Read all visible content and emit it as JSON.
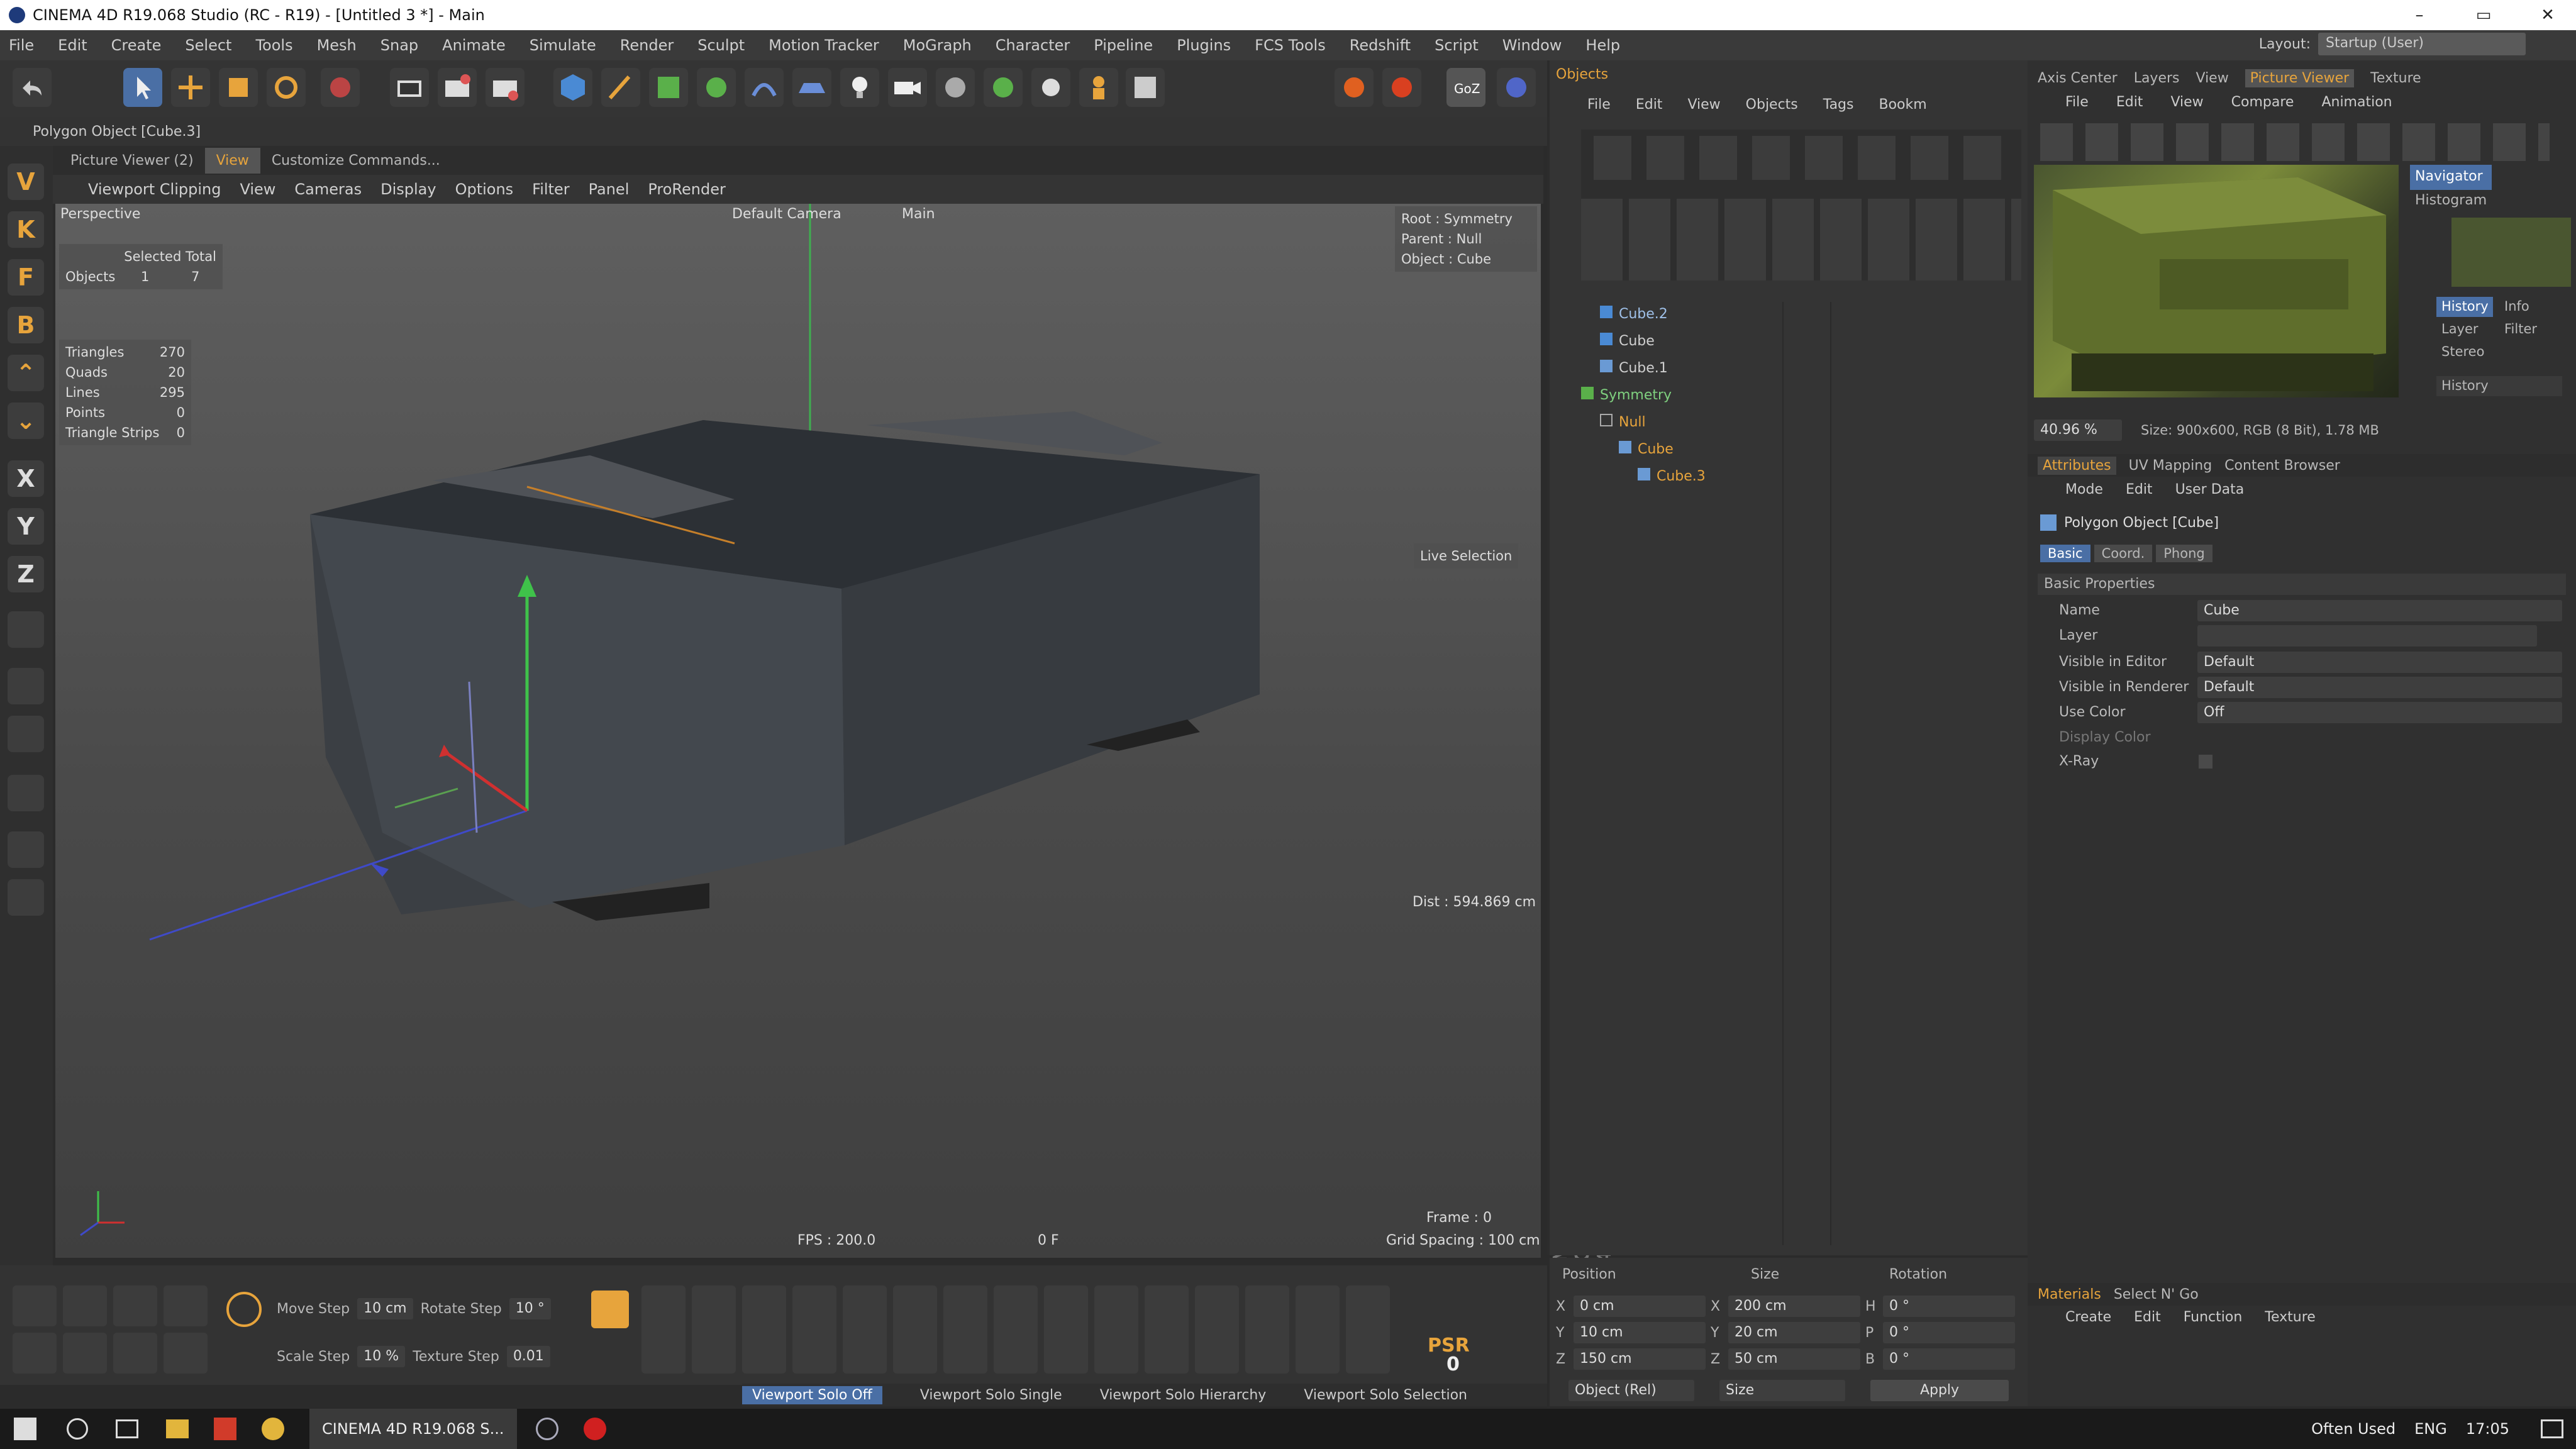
{
  "window": {
    "title": "CINEMA 4D R19.068 Studio (RC - R19) - [Untitled 3 *] - Main",
    "min": "–",
    "max": "▭",
    "close": "✕"
  },
  "menu": [
    "File",
    "Edit",
    "Create",
    "Select",
    "Tools",
    "Mesh",
    "Snap",
    "Animate",
    "Simulate",
    "Render",
    "Sculpt",
    "Motion Tracker",
    "MoGraph",
    "Character",
    "Pipeline",
    "Plugins",
    "FCS Tools",
    "Redshift",
    "Script",
    "Window",
    "Help"
  ],
  "layout": {
    "label": "Layout:",
    "value": "Startup (User)"
  },
  "subbar": {
    "object_label": "Polygon Object [Cube.3]"
  },
  "viewport_tabs": [
    "Picture Viewer (2)",
    "View",
    "Customize Commands..."
  ],
  "viewport_menu": [
    "Viewport Clipping",
    "View",
    "Cameras",
    "Display",
    "Options",
    "Filter",
    "Panel",
    "ProRender"
  ],
  "viewport": {
    "perspective": "Perspective",
    "camera": "Default Camera",
    "main": "Main",
    "selected_hdr": "Selected Total",
    "objects_label": "Objects",
    "objects_sel": "1",
    "objects_total": "7",
    "triangles": "Triangles",
    "triangles_v": "270",
    "quads": "Quads",
    "quads_v": "20",
    "lines": "Lines",
    "lines_v": "295",
    "points": "Points",
    "points_v": "0",
    "strips": "Triangle Strips",
    "strips_v": "0",
    "root": "Root : Symmetry",
    "parent": "Parent : Null",
    "object": "Object : Cube",
    "live": "Live Selection",
    "dist": "Dist : 594.869 cm",
    "fps": "FPS : 200.0",
    "frame0": "0 F",
    "frame": "Frame : 0",
    "grid": "Grid Spacing : 100 cm"
  },
  "left_tools": [
    "V",
    "K",
    "F",
    "B",
    "⌃",
    "⌄",
    "X",
    "Y",
    "Z"
  ],
  "bottom": {
    "move_step": "Move Step",
    "move_val": "10 cm",
    "rotate_step": "Rotate Step",
    "rotate_val": "10 °",
    "scale_step": "Scale Step",
    "scale_val": "10 %",
    "texture_step": "Texture Step",
    "texture_val": "0.01",
    "psr": "PSR",
    "psr_val": "0"
  },
  "solo": [
    "Viewport Solo Off",
    "Viewport Solo Single",
    "Viewport Solo Hierarchy",
    "Viewport Solo Selection"
  ],
  "objects_panel": {
    "title": "Objects",
    "menu": [
      "File",
      "Edit",
      "View",
      "Objects",
      "Tags",
      "Bookm"
    ],
    "items": [
      {
        "name": "Cube.2",
        "color": "#9fc0e8"
      },
      {
        "name": "Cube",
        "color": "#cfcfcf"
      },
      {
        "name": "Cube.1",
        "color": "#cfcfcf"
      },
      {
        "name": "Symmetry",
        "color": "#7fd07f"
      },
      {
        "name": "Null",
        "color": "#e7a43c"
      },
      {
        "name": "Cube",
        "color": "#e7a43c"
      },
      {
        "name": "Cube.3",
        "color": "#e7a43c"
      }
    ]
  },
  "right_tabs": [
    "Axis Center",
    "Layers",
    "View",
    "Picture Viewer",
    "Texture"
  ],
  "pv_menu": [
    "File",
    "Edit",
    "View",
    "Compare",
    "Animation"
  ],
  "pv": {
    "navigator": "Navigator",
    "histogram": "Histogram",
    "history": "History",
    "info": "Info",
    "layer": "Layer",
    "filter": "Filter",
    "stereo": "Stereo",
    "history2": "History",
    "zoom": "40.96 %",
    "size": "Size: 900x600, RGB (8 Bit), 1.78 MB"
  },
  "attr_tabs": [
    "Attributes",
    "UV Mapping",
    "Content Browser"
  ],
  "attr_menu": [
    "Mode",
    "Edit",
    "User Data"
  ],
  "attr": {
    "title": "Polygon Object [Cube]",
    "tabs": [
      "Basic",
      "Coord.",
      "Phong"
    ],
    "section": "Basic Properties",
    "name_l": "Name",
    "name_v": "Cube",
    "layer_l": "Layer",
    "vis_ed": "Visible in Editor",
    "vis_ed_v": "Default",
    "vis_rd": "Visible in Renderer",
    "vis_rd_v": "Default",
    "use_color": "Use Color",
    "use_color_v": "Off",
    "disp_color": "Display Color",
    "xray": "X-Ray"
  },
  "materials": {
    "tabs": [
      "Materials",
      "Select N' Go"
    ],
    "menu": [
      "Create",
      "Edit",
      "Function",
      "Texture"
    ]
  },
  "coords": {
    "position": "Position",
    "size": "Size",
    "rotation": "Rotation",
    "rows": [
      [
        "X",
        "0 cm",
        "X",
        "200 cm",
        "H",
        "0 °"
      ],
      [
        "Y",
        "10 cm",
        "Y",
        "20 cm",
        "P",
        "0 °"
      ],
      [
        "Z",
        "150 cm",
        "Z",
        "50 cm",
        "B",
        "0 °"
      ]
    ],
    "mode": "Object (Rel)",
    "size_mode": "Size",
    "apply": "Apply"
  },
  "taskbar": {
    "app": "CINEMA 4D R19.068 S...",
    "often": "Often Used",
    "lang": "ENG",
    "time": "17:05"
  }
}
